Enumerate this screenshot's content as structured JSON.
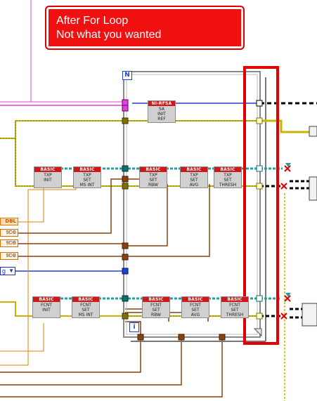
{
  "callout": {
    "line1": "After For Loop",
    "line2": "Not what you wanted"
  },
  "loop": {
    "count_label": "N",
    "iteration_label": "i"
  },
  "subvis": {
    "sa_init_ref": {
      "header": "NI-RFSA",
      "line1": "SA",
      "line2": "INIT",
      "line3": "REF"
    },
    "txp_init": {
      "header": "BASIC",
      "line1": "TXP",
      "line2": "INIT"
    },
    "txp_set_ms_int": {
      "header": "BASIC",
      "line1": "TXP",
      "line2": "SET",
      "line3": "MS INT"
    },
    "txp_set_rbw": {
      "header": "BASIC",
      "line1": "TXP",
      "line2": "SET",
      "line3": "RBW"
    },
    "txp_set_avg": {
      "header": "BASIC",
      "line1": "TXP",
      "line2": "SET",
      "line3": "AVG"
    },
    "txp_set_thresh": {
      "header": "BASIC",
      "line1": "TXP",
      "line2": "SET",
      "line3": "THRESH"
    },
    "fcnt_init": {
      "header": "BASIC",
      "line1": "FCNT",
      "line2": "INIT"
    },
    "fcnt_set_ms_int": {
      "header": "BASIC",
      "line1": "FCNT",
      "line2": "SET",
      "line3": "MS INT"
    },
    "fcnt_set_rbw": {
      "header": "BASIC",
      "line1": "FCNT",
      "line2": "SET",
      "line3": "RBW"
    },
    "fcnt_set_avg": {
      "header": "BASIC",
      "line1": "FCNT",
      "line2": "SET",
      "line3": "AVG"
    },
    "fcnt_set_thresh": {
      "header": "BASIC",
      "line1": "FCNT",
      "line2": "SET",
      "line3": "THRESH"
    }
  },
  "controls": {
    "dbl_label": "DBL",
    "i32_a": "9DB",
    "i32_b": "9DB",
    "i32_c": "9DB",
    "i32_d": "9DB",
    "enum_value": "g"
  },
  "colors": {
    "highlight": "#e00000",
    "error_cluster": "#c8b400",
    "refnum": "#20a0a0",
    "integer": "#2040d0",
    "numeric_orange": "#e08000",
    "string_pink": "#e040e0",
    "wire_brown": "#8a4010"
  }
}
